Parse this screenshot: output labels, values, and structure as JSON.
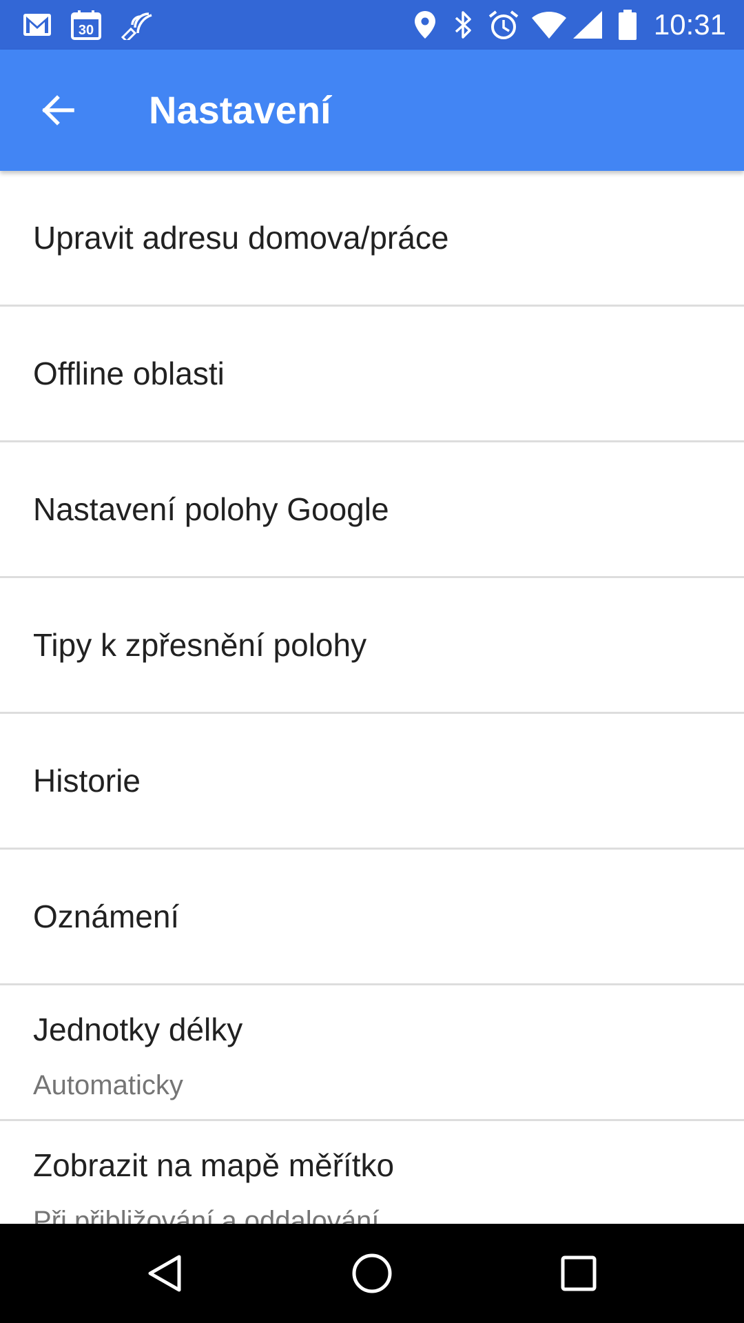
{
  "status_bar": {
    "time": "10:31",
    "left_icons": [
      "gmail-icon",
      "calendar-icon",
      "cast-icon"
    ],
    "calendar_day": "30",
    "right_icons": [
      "location-icon",
      "bluetooth-icon",
      "alarm-icon",
      "wifi-icon",
      "signal-icon",
      "battery-icon"
    ]
  },
  "app_bar": {
    "title": "Nastavení",
    "back_icon": "arrow-back-icon"
  },
  "settings": {
    "items": [
      {
        "label": "Upravit adresu domova/práce"
      },
      {
        "label": "Offline oblasti"
      },
      {
        "label": "Nastavení polohy Google"
      },
      {
        "label": "Tipy k zpřesnění polohy"
      },
      {
        "label": "Historie"
      },
      {
        "label": "Oznámení"
      },
      {
        "label": "Jednotky délky",
        "sublabel": "Automaticky"
      },
      {
        "label": "Zobrazit na mapě měřítko",
        "sublabel": "Při přibližování a oddalování"
      }
    ]
  },
  "nav_bar": {
    "buttons": [
      "back-triangle-icon",
      "home-circle-icon",
      "recents-square-icon"
    ]
  },
  "colors": {
    "status_bar": "#3367d6",
    "app_bar": "#4285f4",
    "text_primary": "#212121",
    "text_secondary": "#757575",
    "divider": "#dddddd",
    "nav_bar": "#000000"
  }
}
